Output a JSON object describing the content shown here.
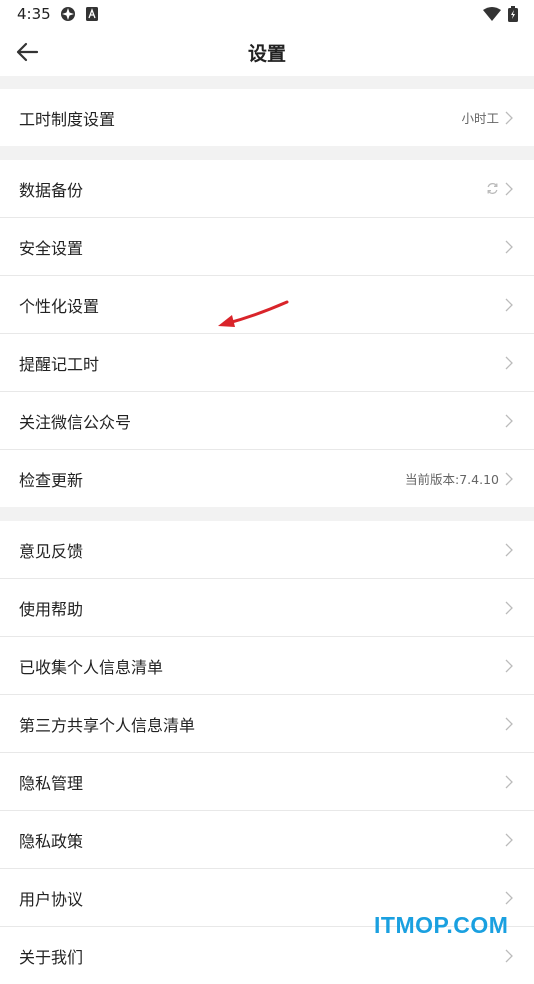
{
  "status_bar": {
    "time": "4:35"
  },
  "header": {
    "title": "设置"
  },
  "groups": [
    {
      "items": [
        {
          "label": "工时制度设置",
          "value": "小时工"
        }
      ]
    },
    {
      "items": [
        {
          "label": "数据备份",
          "icon": "sync-icon"
        },
        {
          "label": "安全设置"
        },
        {
          "label": "个性化设置"
        },
        {
          "label": "提醒记工时"
        },
        {
          "label": "关注微信公众号"
        },
        {
          "label": "检查更新",
          "value": "当前版本:7.4.10"
        }
      ]
    },
    {
      "items": [
        {
          "label": "意见反馈"
        },
        {
          "label": "使用帮助"
        },
        {
          "label": "已收集个人信息清单"
        },
        {
          "label": "第三方共享个人信息清单"
        },
        {
          "label": "隐私管理"
        },
        {
          "label": "隐私政策"
        },
        {
          "label": "用户协议"
        },
        {
          "label": "关于我们"
        }
      ]
    }
  ],
  "watermark": "ITMOP.COM",
  "colors": {
    "accent": "#1aa0e0",
    "arrow": "#d9242a",
    "background": "#f2f2f2"
  }
}
